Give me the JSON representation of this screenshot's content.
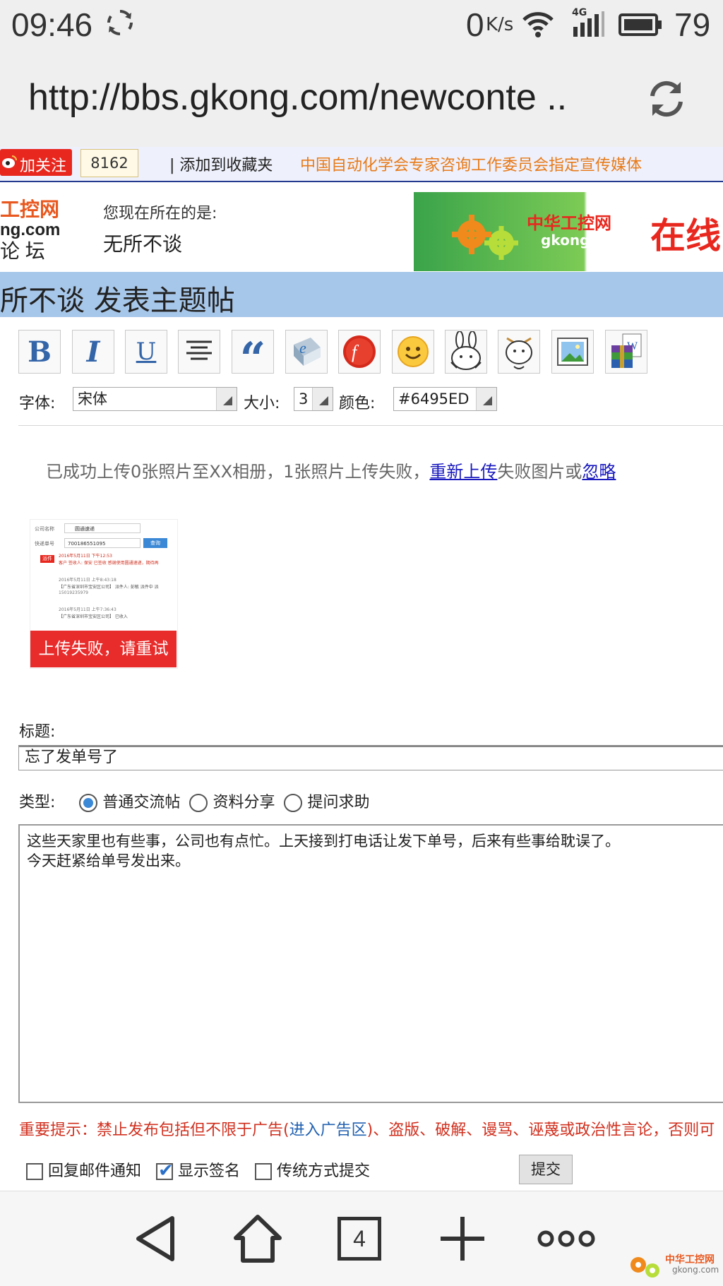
{
  "status_bar": {
    "time": "09:46",
    "net_speed": "0",
    "net_unit": "K/s",
    "network": "4G",
    "battery": "79"
  },
  "browser": {
    "url": "http://bbs.gkong.com/newconte .."
  },
  "top_strip": {
    "follow_label": "加关注",
    "follower_count": "8162",
    "favorite_label": "| 添加到收藏夹",
    "slogan": "中国自动化学会专家咨询工作委员会指定宣传媒体"
  },
  "header": {
    "logo_line1": "工控网",
    "logo_line2": "ng.com",
    "logo_line3": "论 坛",
    "location_label": "您现在所在的是:",
    "location_value": "无所不谈",
    "banner_brand": "中华工控网",
    "banner_domain": "gkong.com",
    "banner_tag": "在线"
  },
  "page_title": "所不谈 发表主题帖",
  "toolbar": {
    "buttons": [
      "bold",
      "italic",
      "underline",
      "align",
      "quote",
      "ie-link",
      "flash",
      "smiley",
      "rabbit-emoticon",
      "cartoon-emoticon",
      "image",
      "attachment"
    ],
    "bold_glyph": "B",
    "italic_glyph": "I",
    "underline_glyph": "U",
    "quote_glyph": "“",
    "font_label": "字体:",
    "font_value": "宋体",
    "size_label": "大小:",
    "size_value": "3",
    "color_label": "颜色:",
    "color_value": "#6495ED"
  },
  "upload_notice": {
    "text_before": "已成功上传0张照片至XX相册，1张照片上传失败，",
    "retry_link": "重新上传",
    "text_middle": "失败图片或",
    "ignore_link": "忽略"
  },
  "thumbnail": {
    "row1_label": "公司名称",
    "row1_value": "圆通速递",
    "row2_label": "快递单号",
    "row2_value": "700186551095",
    "query_button": "查询",
    "status_tag": "派件",
    "status_line1": "2016年5月11日 下午12:53",
    "status_line2": "客户 签收人: 保安 已签收 感谢使用圆通速递，期待再",
    "entry1_time": "2016年5月11日 上午8:43:18",
    "entry1_text": "【广东省深圳市宝安区公司】 派件人: 彭敏 派件中 派",
    "entry1_phone": "15019235979",
    "entry2_time": "2016年5月11日 上午7:36:43",
    "entry2_text": "【广东省深圳市宝安区公司】 已收入",
    "fail_text": "上传失败，请重试"
  },
  "form": {
    "subject_label": "标题:",
    "subject_value": "忘了发单号了",
    "type_label": "类型:",
    "types": [
      "普通交流帖",
      "资料分享",
      "提问求助"
    ],
    "selected_type": 0,
    "body_value": "这些天家里也有些事，公司也有点忙。上天接到打电话让发下单号，后来有些事给耽误了。\n今天赶紧给单号发出来。",
    "warning_prefix": "重要提示：禁止发布包括但不限于广告(",
    "warning_link": "进入广告区",
    "warning_suffix": ")、盗版、破解、谩骂、诬蔑或政治性言论，否则可",
    "options": [
      {
        "label": "回复邮件通知",
        "checked": false
      },
      {
        "label": "显示签名",
        "checked": true
      },
      {
        "label": "传统方式提交",
        "checked": false
      }
    ],
    "submit_label": "提交"
  },
  "bottom_nav": {
    "tab_count": "4",
    "watermark_brand": "中华工控网",
    "watermark_domain": "gkong.com"
  },
  "colors": {
    "title_bar": "#a7c7ea",
    "follow_button": "#e8281f",
    "slogan": "#e87a18",
    "fail_banner": "#e82c2c",
    "warning": "#d0301f",
    "link": "#1a1abf"
  }
}
